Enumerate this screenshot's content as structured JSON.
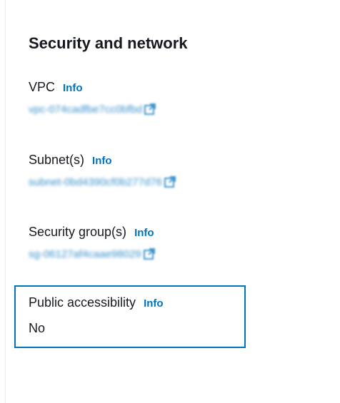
{
  "section": {
    "title": "Security and network"
  },
  "fields": {
    "vpc": {
      "label": "VPC",
      "info": "Info",
      "value": "vpc-074cadfbe7cc0bfbd"
    },
    "subnets": {
      "label": "Subnet(s)",
      "info": "Info",
      "value": "subnet-0bd4390cf0b277d76"
    },
    "security_groups": {
      "label": "Security group(s)",
      "info": "Info",
      "value": "sg-06127af4caae98029"
    },
    "public_accessibility": {
      "label": "Public accessibility",
      "info": "Info",
      "value": "No"
    }
  },
  "icons": {
    "external_link": "external-link-icon"
  },
  "colors": {
    "link": "#0073bb",
    "text": "#16191f",
    "focus_border": "#0073bb",
    "divider": "#eaeded"
  }
}
